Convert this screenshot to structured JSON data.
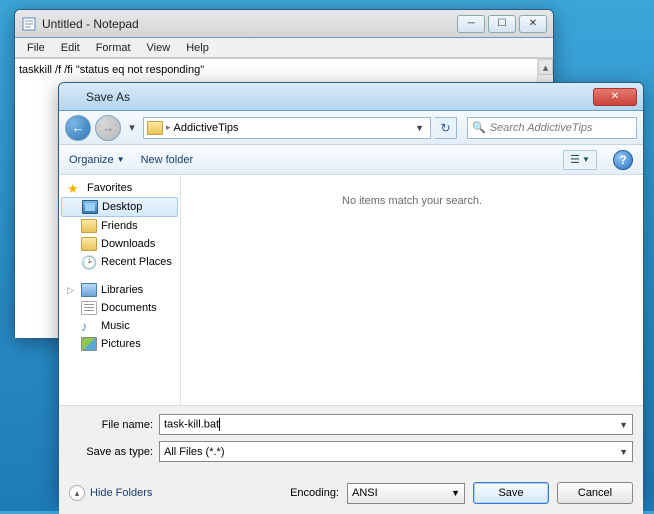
{
  "notepad": {
    "title": "Untitled - Notepad",
    "menu": {
      "file": "File",
      "edit": "Edit",
      "format": "Format",
      "view": "View",
      "help": "Help"
    },
    "content": "taskkill /f /fi \"status eq not responding\""
  },
  "dialog": {
    "title": "Save As",
    "nav": {
      "location": "AddictiveTips",
      "search_placeholder": "Search AddictiveTips"
    },
    "toolbar": {
      "organize": "Organize",
      "newfolder": "New folder"
    },
    "tree": {
      "favorites": "Favorites",
      "items": [
        {
          "label": "Desktop"
        },
        {
          "label": "Friends"
        },
        {
          "label": "Downloads"
        },
        {
          "label": "Recent Places"
        }
      ],
      "libraries": "Libraries",
      "libs": [
        {
          "label": "Documents"
        },
        {
          "label": "Music"
        },
        {
          "label": "Pictures"
        }
      ]
    },
    "empty": "No items match your search.",
    "form": {
      "filename_label": "File name:",
      "filename_value": "task-kill.bat",
      "savetype_label": "Save as type:",
      "savetype_value": "All Files  (*.*)"
    },
    "footer": {
      "hide": "Hide Folders",
      "encoding_label": "Encoding:",
      "encoding_value": "ANSI",
      "save": "Save",
      "cancel": "Cancel"
    }
  }
}
